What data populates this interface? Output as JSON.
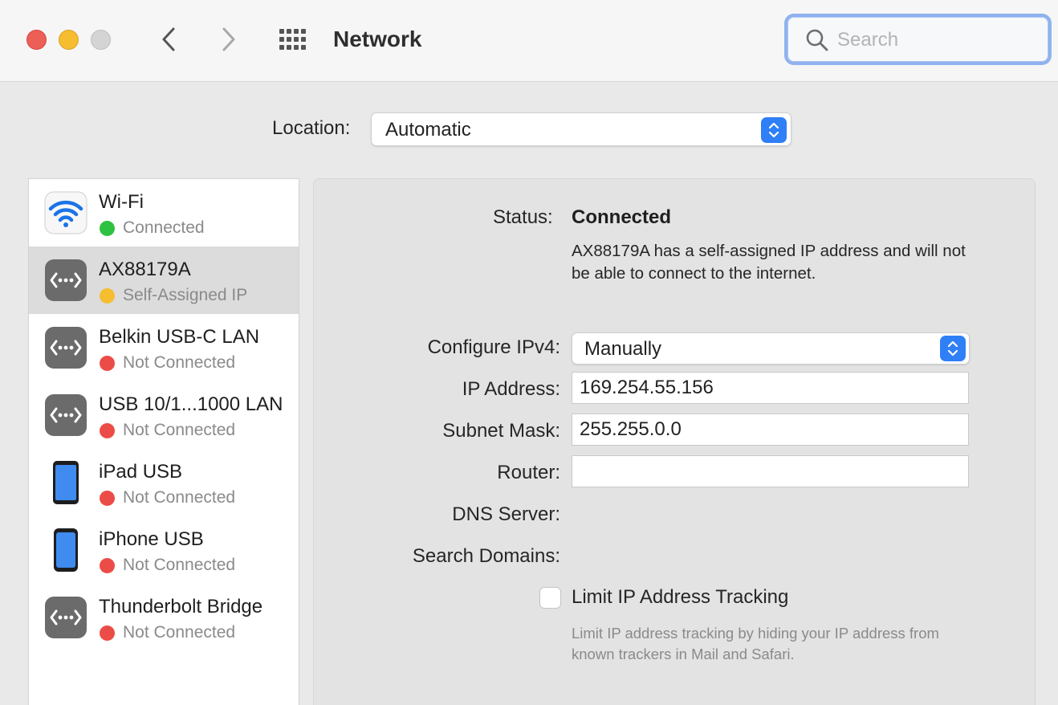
{
  "window": {
    "title": "Network"
  },
  "search": {
    "placeholder": "Search"
  },
  "location": {
    "label": "Location:",
    "value": "Automatic"
  },
  "services": [
    {
      "name": "Wi-Fi",
      "status": "Connected",
      "status_color": "#2fc140",
      "icon": "wifi-icon"
    },
    {
      "name": "AX88179A",
      "status": "Self-Assigned IP",
      "status_color": "#f5bd2f",
      "icon": "ethernet-icon",
      "selected": true
    },
    {
      "name": "Belkin USB-C LAN",
      "status": "Not Connected",
      "status_color": "#ec4c47",
      "icon": "ethernet-icon"
    },
    {
      "name": "USB 10/1...1000 LAN",
      "status": "Not Connected",
      "status_color": "#ec4c47",
      "icon": "ethernet-icon"
    },
    {
      "name": "iPad USB",
      "status": "Not Connected",
      "status_color": "#ec4c47",
      "icon": "ipad-icon"
    },
    {
      "name": "iPhone USB",
      "status": "Not Connected",
      "status_color": "#ec4c47",
      "icon": "iphone-icon"
    },
    {
      "name": "Thunderbolt Bridge",
      "status": "Not Connected",
      "status_color": "#ec4c47",
      "icon": "ethernet-icon"
    }
  ],
  "detail": {
    "status_label": "Status:",
    "status_value": "Connected",
    "status_description": "AX88179A has a self-assigned IP address and will not be able to connect to the internet.",
    "configure_ipv4_label": "Configure IPv4:",
    "configure_ipv4_value": "Manually",
    "ip_address_label": "IP Address:",
    "ip_address_value": "169.254.55.156",
    "subnet_mask_label": "Subnet Mask:",
    "subnet_mask_value": "255.255.0.0",
    "router_label": "Router:",
    "router_value": "",
    "dns_server_label": "DNS Server:",
    "search_domains_label": "Search Domains:",
    "limit_tracking_label": "Limit IP Address Tracking",
    "limit_tracking_checked": false,
    "limit_tracking_help": "Limit IP address tracking by hiding your IP address from known trackers in Mail and Safari."
  },
  "colors": {
    "accent": "#2f7ff6",
    "focus_ring": "#8fb2ee"
  }
}
